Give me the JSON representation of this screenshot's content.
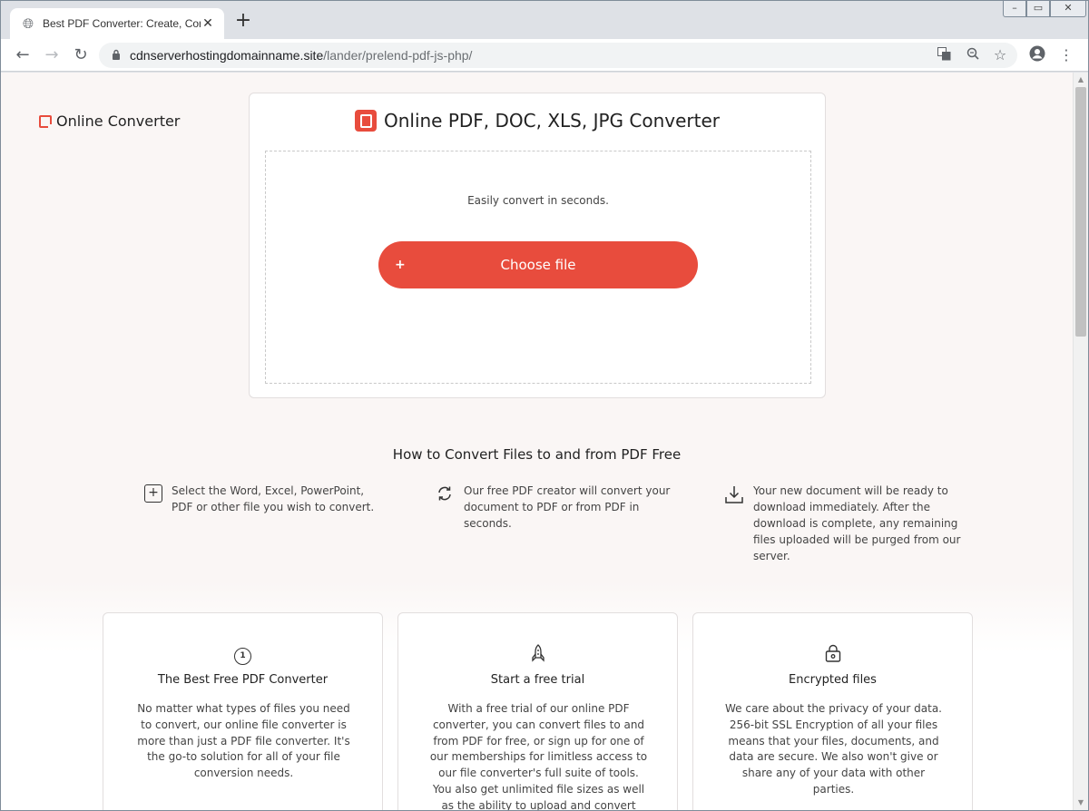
{
  "browser": {
    "tab_title": "Best PDF Converter: Create, Conve",
    "tab_close": "✕",
    "new_tab": "+",
    "url_host": "cdnserverhostingdomainname.site",
    "url_path": "/lander/prelend-pdf-js-php/",
    "window_controls": {
      "minimize": "–",
      "maximize": "▭",
      "close": "✕"
    }
  },
  "page": {
    "logo_text": "Online Converter",
    "converter": {
      "title": "Online PDF, DOC, XLS, JPG Converter",
      "tagline": "Easily convert in seconds.",
      "choose_file_plus": "+",
      "choose_file_label": "Choose file"
    },
    "howto": {
      "title": "How to Convert Files to and from PDF Free",
      "steps": [
        {
          "icon": "plus-square-icon",
          "line1": "Select the Word, Excel, PowerPoint,",
          "line2": "PDF or other file you wish to convert."
        },
        {
          "icon": "refresh-icon",
          "line1": "Our free PDF creator will convert your",
          "line2": "document to PDF or from PDF in",
          "line3": "seconds."
        },
        {
          "icon": "download-icon",
          "line1": "Your new document will be ready to",
          "line2": "download immediately. After the",
          "line3": "download is complete, any remaining",
          "line4": "files uploaded will be purged from our",
          "line5": "server."
        }
      ]
    },
    "features": [
      {
        "icon": "number-one-icon",
        "icon_text": "1",
        "title": "The Best Free PDF Converter",
        "body": "No matter what types of files you need to convert, our online file converter is more than just a PDF file converter. It's the go-to solution for all of your file conversion needs."
      },
      {
        "icon": "rocket-icon",
        "title": "Start a free trial",
        "body": "With a free trial of our online PDF converter, you can convert files to and from PDF for free, or sign up for one of our memberships for limitless access to our file converter's full suite of tools. You also get unlimited file sizes as well as the ability to upload and convert several files"
      },
      {
        "icon": "lock-icon",
        "title": "Encrypted files",
        "body": "We care about the privacy of your data. 256-bit SSL Encryption of all your files means that your files, documents, and data are secure. We also won't give or share any of your data with other parties."
      }
    ]
  },
  "colors": {
    "accent": "#e84c3d",
    "page_bg": "#faf6f5"
  }
}
